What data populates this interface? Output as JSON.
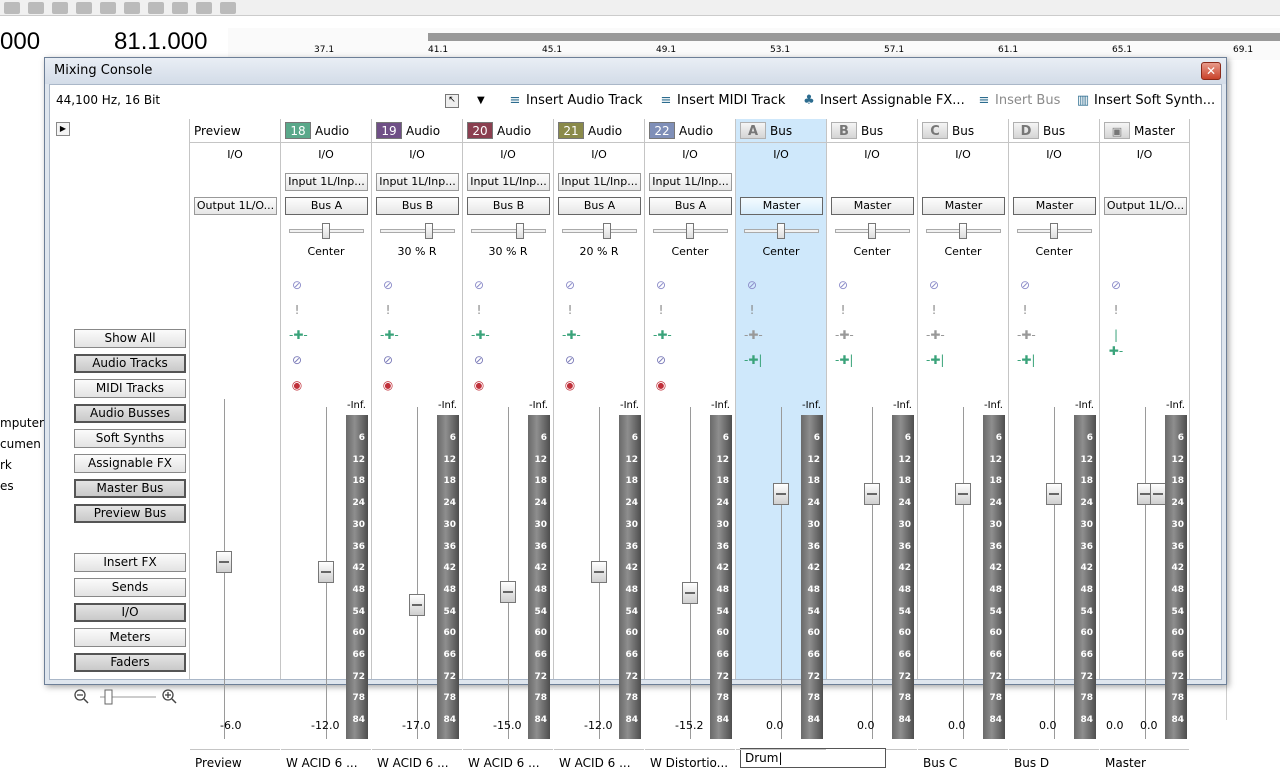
{
  "bg": {
    "time_left": "000",
    "time_right": "81.1.000",
    "timeline_marks": [
      "37.1",
      "41.1",
      "45.1",
      "49.1",
      "53.1",
      "57.1",
      "61.1",
      "65.1",
      "69.1"
    ],
    "left_labels": [
      "mputer",
      "cumen",
      "rk",
      "es"
    ]
  },
  "window": {
    "title": "Mixing Console",
    "close_label": "✕",
    "sample_rate": "44,100 Hz, 16 Bit",
    "toolbar": [
      {
        "label": "Insert Audio Track",
        "icon": "audio-track-icon",
        "disabled": false
      },
      {
        "label": "Insert MIDI Track",
        "icon": "midi-track-icon",
        "disabled": false
      },
      {
        "label": "Insert Assignable FX...",
        "icon": "assignable-fx-icon",
        "disabled": false
      },
      {
        "label": "Insert Bus",
        "icon": "bus-icon",
        "disabled": true
      },
      {
        "label": "Insert Soft Synth...",
        "icon": "soft-synth-icon",
        "disabled": false
      }
    ]
  },
  "left_panel": {
    "view_buttons": [
      {
        "label": "Show All",
        "on": false
      },
      {
        "label": "Audio Tracks",
        "on": true
      },
      {
        "label": "MIDI Tracks",
        "on": false
      },
      {
        "label": "Audio Busses",
        "on": true
      },
      {
        "label": "Soft Synths",
        "on": false
      },
      {
        "label": "Assignable FX",
        "on": false
      },
      {
        "label": "Master Bus",
        "on": true
      },
      {
        "label": "Preview Bus",
        "on": true
      }
    ],
    "section_buttons": [
      {
        "label": "Insert FX",
        "on": false
      },
      {
        "label": "Sends",
        "on": false
      },
      {
        "label": "I/O",
        "on": true
      },
      {
        "label": "Meters",
        "on": false
      },
      {
        "label": "Faders",
        "on": true
      }
    ]
  },
  "strips": [
    {
      "type": "Preview",
      "badge": "",
      "badge_color": "",
      "io": "I/O",
      "input": "",
      "output": "Output 1L/O...",
      "pan": "",
      "gain": "-6.0",
      "name": "Preview",
      "fader_level": -6.0,
      "selected": false,
      "kind": "preview"
    },
    {
      "type": "Audio",
      "badge": "18",
      "badge_color": "#5aa88a",
      "io": "I/O",
      "input": "Input 1L/Inp...",
      "output": "Bus A",
      "pan": "Center",
      "gain": "-12.0",
      "name": "W ACID 6 ...",
      "fader_level": -12.0,
      "selected": false,
      "kind": "audio"
    },
    {
      "type": "Audio",
      "badge": "19",
      "badge_color": "#6f4f86",
      "io": "I/O",
      "input": "Input 1L/Inp...",
      "output": "Bus B",
      "pan": "30 % R",
      "gain": "-17.0",
      "name": "W ACID 6 ...",
      "fader_level": -17.0,
      "selected": false,
      "kind": "audio"
    },
    {
      "type": "Audio",
      "badge": "20",
      "badge_color": "#8a3f50",
      "io": "I/O",
      "input": "Input 1L/Inp...",
      "output": "Bus B",
      "pan": "30 % R",
      "gain": "-15.0",
      "name": "W ACID 6 ...",
      "fader_level": -15.0,
      "selected": false,
      "kind": "audio"
    },
    {
      "type": "Audio",
      "badge": "21",
      "badge_color": "#8a8a4a",
      "io": "I/O",
      "input": "Input 1L/Inp...",
      "output": "Bus A",
      "pan": "20 % R",
      "gain": "-12.0",
      "name": "W ACID 6 ...",
      "fader_level": -12.0,
      "selected": false,
      "kind": "audio"
    },
    {
      "type": "Audio",
      "badge": "22",
      "badge_color": "#7f8fb8",
      "io": "I/O",
      "input": "Input 1L/Inp...",
      "output": "Bus A",
      "pan": "Center",
      "gain": "-15.2",
      "name": "W Distortio...",
      "fader_level": -15.2,
      "selected": false,
      "kind": "audio"
    },
    {
      "type": "Bus",
      "badge": "A",
      "badge_color": "",
      "io": "I/O",
      "input": "",
      "output": "Master",
      "pan": "Center",
      "gain": "0.0",
      "name": "Drum",
      "fader_level": 0.0,
      "selected": true,
      "kind": "bus"
    },
    {
      "type": "Bus",
      "badge": "B",
      "badge_color": "",
      "io": "I/O",
      "input": "",
      "output": "Master",
      "pan": "Center",
      "gain": "0.0",
      "name": "",
      "fader_level": 0.0,
      "selected": false,
      "kind": "bus"
    },
    {
      "type": "Bus",
      "badge": "C",
      "badge_color": "",
      "io": "I/O",
      "input": "",
      "output": "Master",
      "pan": "Center",
      "gain": "0.0",
      "name": "Bus C",
      "fader_level": 0.0,
      "selected": false,
      "kind": "bus"
    },
    {
      "type": "Bus",
      "badge": "D",
      "badge_color": "",
      "io": "I/O",
      "input": "",
      "output": "Master",
      "pan": "Center",
      "gain": "0.0",
      "name": "Bus D",
      "fader_level": 0.0,
      "selected": false,
      "kind": "bus"
    },
    {
      "type": "Master",
      "badge": "",
      "badge_color": "",
      "io": "I/O",
      "input": "",
      "output": "Output 1L/O...",
      "pan": "",
      "gain": "0.0",
      "gain2": "0.0",
      "name": "Master",
      "fader_level": 0.0,
      "selected": false,
      "kind": "master"
    }
  ],
  "meter_scale": [
    "6",
    "12",
    "18",
    "24",
    "30",
    "36",
    "42",
    "48",
    "54",
    "60",
    "66",
    "72",
    "78",
    "84"
  ],
  "meter_top_label": "-Inf.",
  "colors": {
    "selected_strip": "#cfe8fb",
    "mute": "#8a8ac8",
    "record": "#c0303a",
    "fx": "#3aa37a"
  }
}
